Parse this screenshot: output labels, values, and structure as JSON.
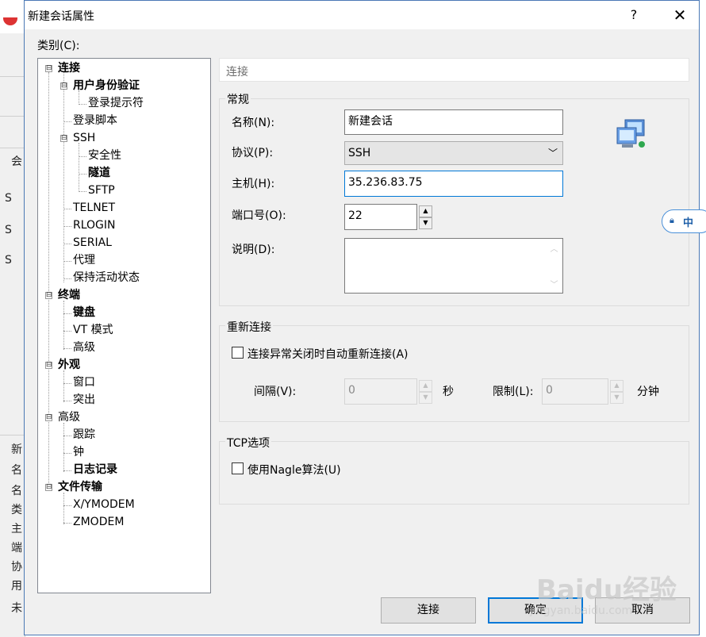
{
  "background_window": {
    "side_texts": [
      "会",
      "S",
      "S",
      "S",
      "新",
      "名",
      "名",
      "类",
      "主",
      "端",
      "协",
      "用",
      "未"
    ]
  },
  "dialog": {
    "title": "新建会话属性",
    "help_label": "?",
    "close_label": "✕",
    "category_label": "类别(C):",
    "tree": [
      {
        "label": "连接",
        "bold": true,
        "expander": "⊟"
      },
      {
        "label": "用户身份验证",
        "bold": true,
        "expander": "⊟"
      },
      {
        "label": "登录提示符",
        "bold": false
      },
      {
        "label": "登录脚本",
        "bold": false
      },
      {
        "label": "SSH",
        "bold": false,
        "expander": "⊟"
      },
      {
        "label": "安全性",
        "bold": false
      },
      {
        "label": "隧道",
        "bold": true
      },
      {
        "label": "SFTP",
        "bold": false
      },
      {
        "label": "TELNET",
        "bold": false
      },
      {
        "label": "RLOGIN",
        "bold": false
      },
      {
        "label": "SERIAL",
        "bold": false
      },
      {
        "label": "代理",
        "bold": false
      },
      {
        "label": "保持活动状态",
        "bold": false
      },
      {
        "label": "终端",
        "bold": true,
        "expander": "⊟"
      },
      {
        "label": "键盘",
        "bold": true
      },
      {
        "label": "VT 模式",
        "bold": false
      },
      {
        "label": "高级",
        "bold": false
      },
      {
        "label": "外观",
        "bold": true,
        "expander": "⊟"
      },
      {
        "label": "窗口",
        "bold": false
      },
      {
        "label": "突出",
        "bold": false
      },
      {
        "label": "高级",
        "bold": false,
        "expander": "⊟"
      },
      {
        "label": "跟踪",
        "bold": false
      },
      {
        "label": "钟",
        "bold": false
      },
      {
        "label": "日志记录",
        "bold": true
      },
      {
        "label": "文件传输",
        "bold": true,
        "expander": "⊟"
      },
      {
        "label": "X/YMODEM",
        "bold": false
      },
      {
        "label": "ZMODEM",
        "bold": false
      }
    ],
    "panel_header": "连接",
    "general": {
      "group_label": "常规",
      "name_label": "名称(N):",
      "name_value": "新建会话",
      "protocol_label": "协议(P):",
      "protocol_value": "SSH",
      "host_label": "主机(H):",
      "host_value": "35.236.83.75",
      "port_label": "端口号(O):",
      "port_value": "22",
      "desc_label": "说明(D):",
      "desc_value": ""
    },
    "reconnect": {
      "group_label": "重新连接",
      "auto_label": "连接异常关闭时自动重新连接(A)",
      "auto_checked": false,
      "interval_label": "间隔(V):",
      "interval_value": "0",
      "interval_unit": "秒",
      "limit_label": "限制(L):",
      "limit_value": "0",
      "limit_unit": "分钟"
    },
    "tcp": {
      "group_label": "TCP选项",
      "nagle_label": "使用Nagle算法(U)",
      "nagle_checked": false
    },
    "buttons": {
      "connect": "连接",
      "ok": "确定",
      "cancel": "取消"
    }
  },
  "ime": {
    "label": "中"
  },
  "watermark": {
    "brand": "Baidu经验",
    "url": "jingyan.baidu.com"
  },
  "colors": {
    "focus": "#0078d7",
    "dialog_bg": "#f0f0f0",
    "border": "#4a78b5"
  }
}
